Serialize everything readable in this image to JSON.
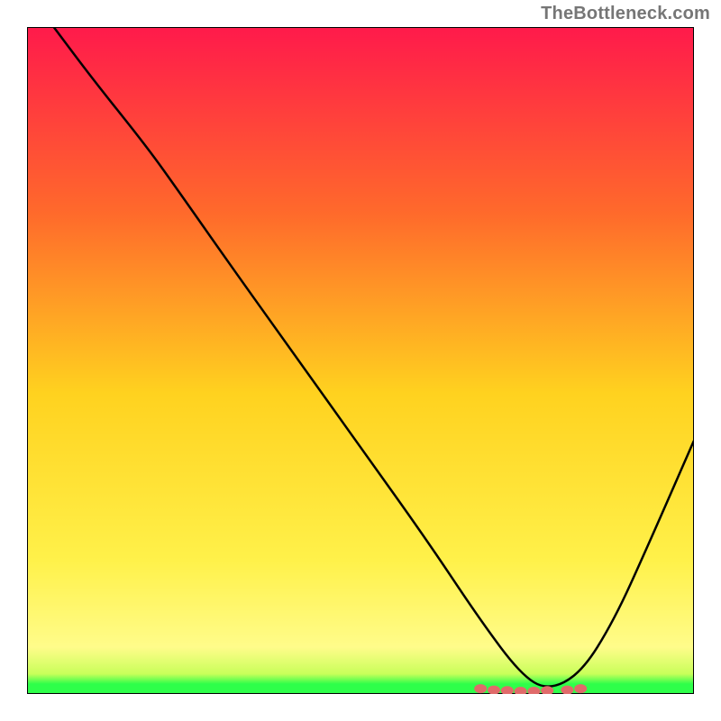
{
  "watermark": "TheBottleneck.com",
  "chart_data": {
    "type": "line",
    "title": "",
    "xlabel": "",
    "ylabel": "",
    "xlim": [
      0,
      100
    ],
    "ylim": [
      0,
      100
    ],
    "background_gradient": {
      "top": "#ff1a4b",
      "mid_upper": "#ff8a2b",
      "mid": "#ffd21f",
      "mid_lower": "#fff84a",
      "green_band": "#2eff4a"
    },
    "series": [
      {
        "name": "bottleneck-curve",
        "color": "#000000",
        "x": [
          4,
          10,
          18,
          23,
          30,
          40,
          50,
          60,
          68,
          74,
          78,
          83,
          88,
          93,
          100
        ],
        "y": [
          100,
          92,
          82,
          75,
          65,
          51,
          37,
          23,
          11,
          3,
          0.5,
          3,
          11,
          22,
          38
        ]
      }
    ],
    "markers": {
      "name": "bottom-dots",
      "color": "#e06a6a",
      "points": [
        {
          "x": 68,
          "y": 0.8
        },
        {
          "x": 70,
          "y": 0.6
        },
        {
          "x": 72,
          "y": 0.5
        },
        {
          "x": 74,
          "y": 0.4
        },
        {
          "x": 76,
          "y": 0.4
        },
        {
          "x": 78,
          "y": 0.5
        },
        {
          "x": 81,
          "y": 0.6
        },
        {
          "x": 83,
          "y": 0.8
        }
      ]
    }
  }
}
